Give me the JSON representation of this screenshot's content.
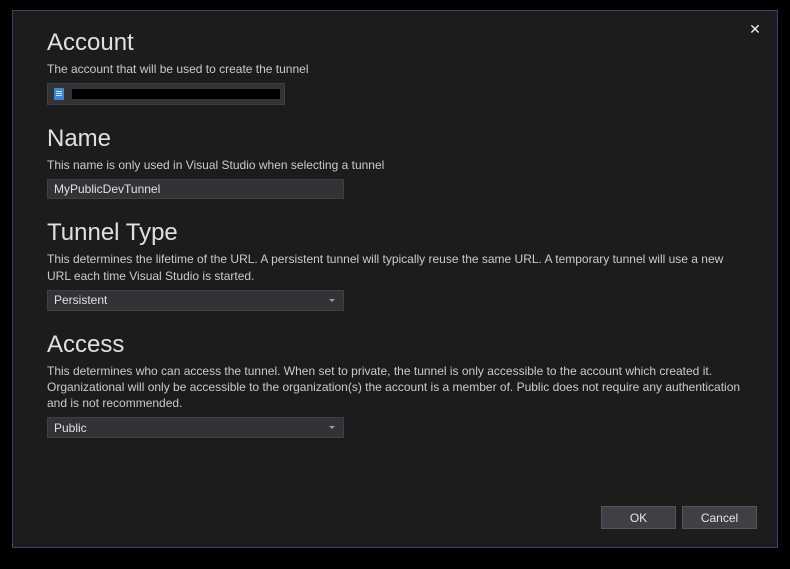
{
  "dialog": {
    "close_symbol": "✕"
  },
  "account": {
    "title": "Account",
    "desc": "The account that will be used to create the tunnel",
    "icon_name": "account-icon"
  },
  "name": {
    "title": "Name",
    "desc": "This name is only used in Visual Studio when selecting a tunnel",
    "value": "MyPublicDevTunnel"
  },
  "tunnel_type": {
    "title": "Tunnel Type",
    "desc": "This determines the lifetime of the URL. A persistent tunnel will typically reuse the same URL. A temporary tunnel will use a new URL each time Visual Studio is started.",
    "selected": "Persistent"
  },
  "access": {
    "title": "Access",
    "desc": "This determines who can access the tunnel. When set to private, the tunnel is only accessible to the account which created it. Organizational will only be accessible to the organization(s) the account is a member of. Public does not require any authentication and is not recommended.",
    "selected": "Public"
  },
  "footer": {
    "ok_label": "OK",
    "cancel_label": "Cancel"
  }
}
